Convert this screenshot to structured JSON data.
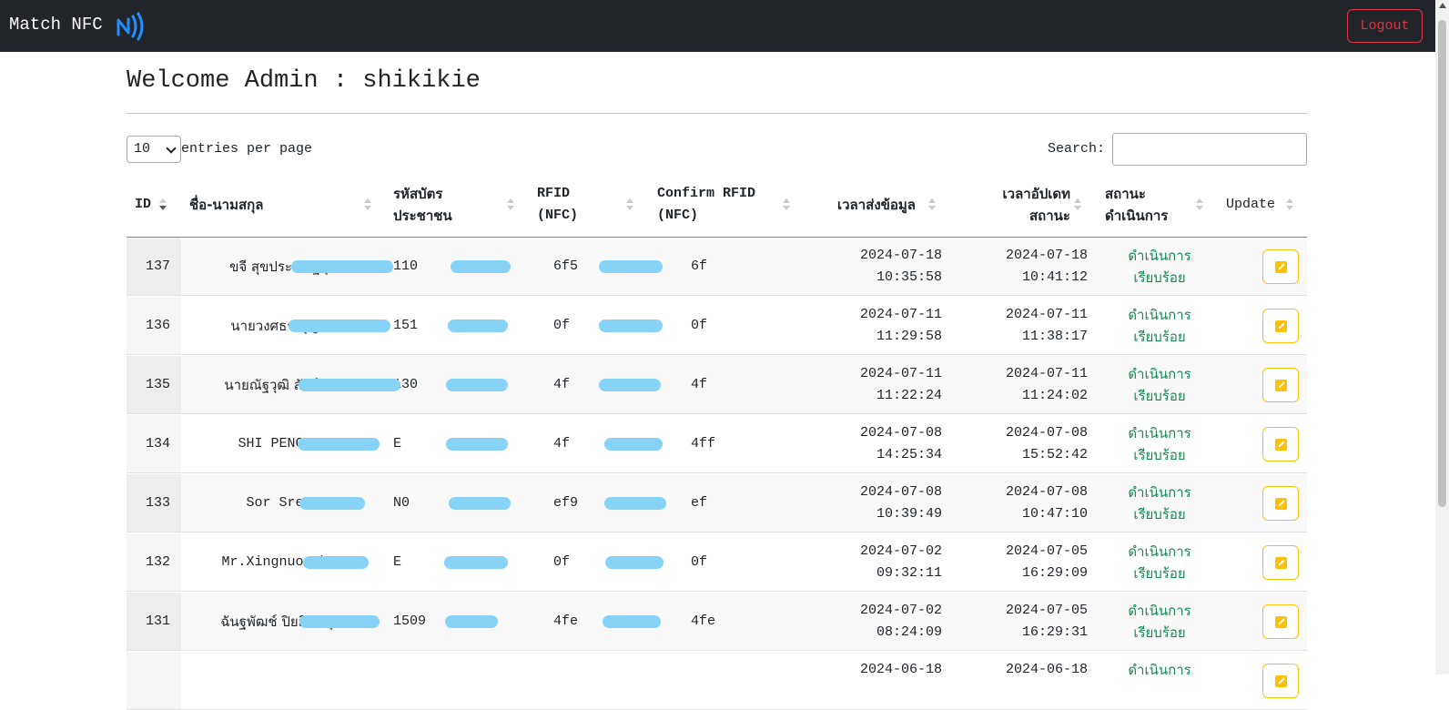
{
  "navbar": {
    "brand": "Match NFC",
    "brand_icon": "nfc-icon",
    "logout_label": "Logout",
    "logout_color": "#dc3545"
  },
  "welcome": "Welcome Admin : shikikie",
  "controls": {
    "per_page_value": "10",
    "per_page_label": "entries per page",
    "search_label": "Search:",
    "search_value": ""
  },
  "table": {
    "headers": {
      "id": "ID",
      "name": "ชื่อ-นามสกุล",
      "cid_1": "รหัสบัตร",
      "cid_2": "ประชาชน",
      "rfid_1": "RFID",
      "rfid_2": "(NFC)",
      "crfid_1": "Confirm RFID",
      "crfid_2": "(NFC)",
      "sent": "เวลาส่งข้อมูล",
      "upd_1": "เวลาอัปเดท",
      "upd_2": "สถานะ",
      "status_1": "สถานะ",
      "status_2": "ดำเนินการ",
      "update": "Update"
    },
    "rows": [
      {
        "id": "137",
        "name": "ขจี  สุขประเสริฐกุล",
        "cid": "110",
        "rfid": "6f5",
        "crfid": "6f",
        "sent_date": "2024-07-18",
        "sent_time": "10:35:58",
        "upd_date": "2024-07-18",
        "upd_time": "10:41:12",
        "status_1": "ดำเนินการ",
        "status_2": "เรียบร้อย"
      },
      {
        "id": "136",
        "name": "นายวงศธร  บุญมา",
        "cid": "151",
        "rfid": "0f",
        "crfid": "0f",
        "sent_date": "2024-07-11",
        "sent_time": "11:29:58",
        "upd_date": "2024-07-11",
        "upd_time": "11:38:17",
        "status_1": "ดำเนินการ",
        "status_2": "เรียบร้อย"
      },
      {
        "id": "135",
        "name": "นายณัฐวุฒิ  สังข์ทอง",
        "cid": "130",
        "rfid": "4f",
        "crfid": "4f",
        "sent_date": "2024-07-11",
        "sent_time": "11:22:24",
        "upd_date": "2024-07-11",
        "upd_time": "11:24:02",
        "status_1": "ดำเนินการ",
        "status_2": "เรียบร้อย"
      },
      {
        "id": "134",
        "name": "SHI PENGWEN",
        "cid": "E",
        "rfid": "4f",
        "crfid": "4ff",
        "sent_date": "2024-07-08",
        "sent_time": "14:25:34",
        "upd_date": "2024-07-08",
        "upd_time": "15:52:42",
        "status_1": "ดำเนินการ",
        "status_2": "เรียบร้อย"
      },
      {
        "id": "133",
        "name": "Sor Sreng",
        "cid": "N0",
        "rfid": "ef9",
        "crfid": "ef",
        "sent_date": "2024-07-08",
        "sent_time": "10:39:49",
        "upd_date": "2024-07-08",
        "upd_time": "10:47:10",
        "status_1": "ดำเนินการ",
        "status_2": "เรียบร้อย"
      },
      {
        "id": "132",
        "name": "Mr.Xingnuo Chen",
        "cid": "E",
        "rfid": "0f",
        "crfid": "0f",
        "sent_date": "2024-07-02",
        "sent_time": "09:32:11",
        "upd_date": "2024-07-05",
        "upd_time": "16:29:09",
        "status_1": "ดำเนินการ",
        "status_2": "เรียบร้อย"
      },
      {
        "id": "131",
        "name": "ฉันฐพัฒช์  ปิยสิทธิคุณ",
        "cid": "1509",
        "rfid": "4fe",
        "crfid": "4fe",
        "sent_date": "2024-07-02",
        "sent_time": "08:24:09",
        "upd_date": "2024-07-05",
        "upd_time": "16:29:31",
        "status_1": "ดำเนินการ",
        "status_2": "เรียบร้อย"
      },
      {
        "id": "",
        "name": "",
        "cid": "",
        "rfid": "",
        "crfid": "",
        "sent_date": "2024-06-18",
        "sent_time": "",
        "upd_date": "2024-06-18",
        "upd_time": "",
        "status_1": "ดำเนินการ",
        "status_2": ""
      }
    ],
    "edit_icon": "pencil-square-icon",
    "status_color": "#198754",
    "button_color": "#ffc107"
  }
}
